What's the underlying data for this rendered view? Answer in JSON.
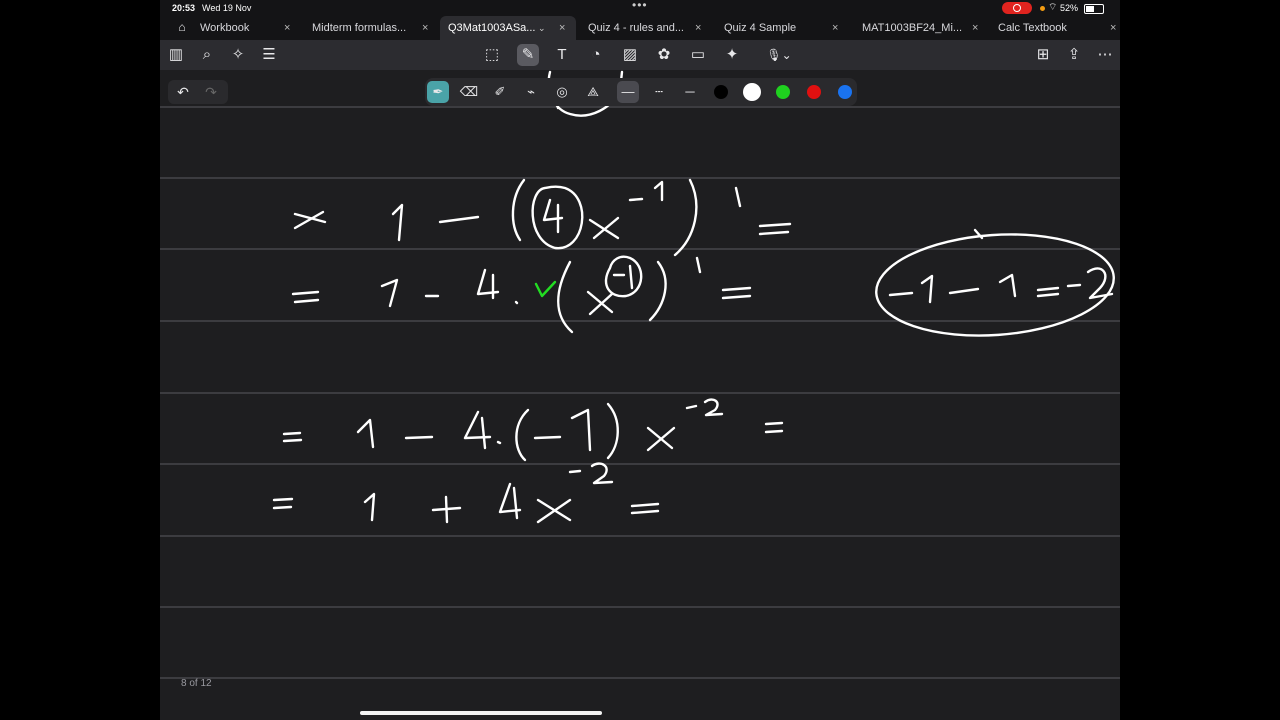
{
  "status": {
    "time": "20:53",
    "date": "Wed 19 Nov",
    "battery": "52%"
  },
  "tabs": [
    {
      "label": "Workbook",
      "active": false
    },
    {
      "label": "Midterm formulas...",
      "active": false
    },
    {
      "label": "Q3Mat1003ASa...",
      "active": true
    },
    {
      "label": "Quiz 4 - rules and...",
      "active": false
    },
    {
      "label": "Quiz 4 Sample",
      "active": false
    },
    {
      "label": "MAT1003BF24_Mi...",
      "active": false
    },
    {
      "label": "Calc Textbook",
      "active": false
    }
  ],
  "toolbar": {
    "left_icons": [
      "sidebar-icon",
      "search-icon",
      "magic-icon",
      "outline-icon"
    ],
    "center_icons": [
      "selection-icon",
      "pen-icon",
      "text-icon",
      "shapes-icon",
      "image-icon",
      "elements-icon",
      "comment-icon",
      "laser-icon",
      "microphone-icon"
    ],
    "right_icons": [
      "new-page-icon",
      "share-icon",
      "more-icon"
    ]
  },
  "pen_tools": {
    "tools": [
      "fountain-pen",
      "eraser",
      "ballpoint",
      "highlighter",
      "lasso",
      "shape-tool"
    ],
    "line_styles": [
      "solid",
      "dashed",
      "thin"
    ],
    "colors": [
      "#000000",
      "#ffffff",
      "#1fd11f",
      "#e01010",
      "#1a73f0"
    ],
    "selected_color": "#ffffff"
  },
  "ink_colors": {
    "primary": "#ffffff",
    "accent": "#22dd22"
  },
  "page": {
    "indicator": "8 of 12"
  }
}
